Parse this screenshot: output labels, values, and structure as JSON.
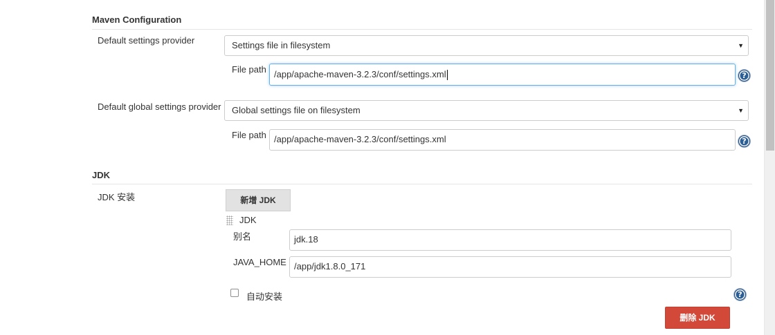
{
  "maven": {
    "title": "Maven Configuration",
    "default_settings": {
      "label": "Default settings provider",
      "selected": "Settings file in filesystem",
      "file_path_label": "File path",
      "file_path_value": "/app/apache-maven-3.2.3/conf/settings.xml"
    },
    "global_settings": {
      "label": "Default global settings provider",
      "selected": "Global settings file on filesystem",
      "file_path_label": "File path",
      "file_path_value": "/app/apache-maven-3.2.3/conf/settings.xml"
    }
  },
  "jdk": {
    "title": "JDK",
    "install_label": "JDK 安装",
    "add_button": "新增 JDK",
    "item_header": "JDK",
    "alias_label": "别名",
    "alias_value": "jdk.18",
    "java_home_label": "JAVA_HOME",
    "java_home_value": "/app/jdk1.8.0_171",
    "auto_install_label": "自动安装",
    "auto_install_checked": false,
    "delete_button": "删除 JDK"
  },
  "icons": {
    "help": "?",
    "dropdown_arrow": "▼"
  },
  "colors": {
    "delete_button": "#d24939",
    "help_icon": "#2d5f97",
    "focus_border": "#66afe9"
  }
}
